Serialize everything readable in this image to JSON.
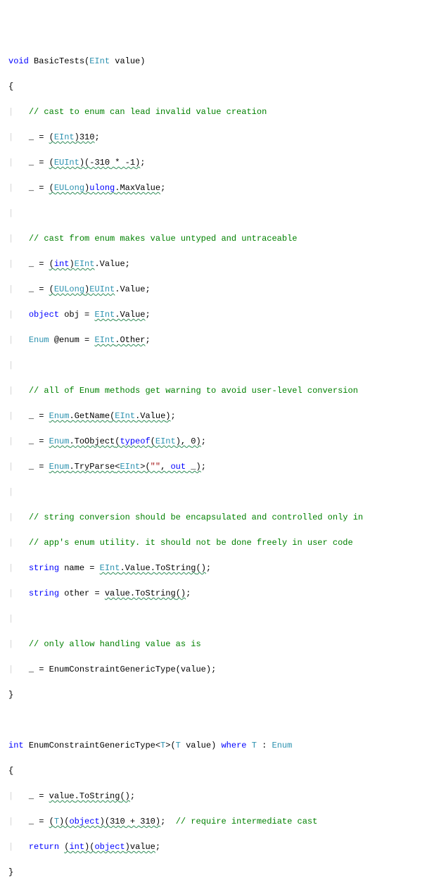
{
  "code": {
    "l1": {
      "kw_void": "void",
      "name": "BasicTests",
      "p_type": "EInt",
      "p_name": "value"
    },
    "l2": {
      "brace": "{"
    },
    "c1": "// cast to enum can lead invalid value creation",
    "l4": {
      "u": "_",
      "eq": "=",
      "cast_t": "EInt",
      "num": "310"
    },
    "l5": {
      "u": "_",
      "eq": "=",
      "cast_t": "EUInt",
      "expr_a": "-310",
      "star": "*",
      "expr_b": "-1"
    },
    "l6": {
      "u": "_",
      "eq": "=",
      "cast_t": "EULong",
      "t2": "ulong",
      "m": "MaxValue"
    },
    "c2": "// cast from enum makes value untyped and untraceable",
    "l9": {
      "u": "_",
      "eq": "=",
      "cast_t": "int",
      "t2": "EInt",
      "m": "Value"
    },
    "l10": {
      "u": "_",
      "eq": "=",
      "cast_t": "EULong",
      "t2": "EUInt",
      "m": "Value"
    },
    "l11": {
      "kw": "object",
      "v": "obj",
      "eq": "=",
      "t": "EInt",
      "m": "Value"
    },
    "l12": {
      "t": "Enum",
      "v": "@enum",
      "eq": "=",
      "t2": "EInt",
      "m": "Other"
    },
    "c3": "// all of Enum methods get warning to avoid user-level conversion",
    "l15": {
      "u": "_",
      "eq": "=",
      "t": "Enum",
      "m": "GetName",
      "a_t": "EInt",
      "a_m": "Value"
    },
    "l16": {
      "u": "_",
      "eq": "=",
      "t": "Enum",
      "m": "ToObject",
      "kw": "typeof",
      "a_t": "EInt",
      "num": "0"
    },
    "l17": {
      "u": "_",
      "eq": "=",
      "t": "Enum",
      "m": "TryParse",
      "g": "EInt",
      "s": "\"\"",
      "kw": "out",
      "u2": "_"
    },
    "c4a": "// string conversion should be encapsulated and controlled only in",
    "c4b": "// app's enum utility. it should not be done freely in user code",
    "l21": {
      "kw": "string",
      "v": "name",
      "eq": "=",
      "t": "EInt",
      "m": "Value",
      "fn": "ToString"
    },
    "l22": {
      "kw": "string",
      "v": "other",
      "eq": "=",
      "id": "value",
      "fn": "ToString"
    },
    "c5": "// only allow handling value as is",
    "l25": {
      "u": "_",
      "eq": "=",
      "fn": "EnumConstraintGenericType",
      "arg": "value"
    },
    "l26": {
      "brace": "}"
    },
    "l28": {
      "kw_int": "int",
      "name": "EnumConstraintGenericType",
      "g": "T",
      "p_type": "T",
      "p_name": "value",
      "kw_where": "where",
      "tc": "T",
      "kw_colon": ":",
      "base": "Enum"
    },
    "l29": {
      "brace": "{"
    },
    "l30": {
      "u": "_",
      "eq": "=",
      "id": "value",
      "fn": "ToString"
    },
    "l31": {
      "u": "_",
      "eq": "=",
      "c1": "T",
      "c2": "object",
      "a": "310",
      "plus": "+",
      "b": "310",
      "cm": "// require intermediate cast"
    },
    "l32": {
      "kw": "return",
      "c1": "int",
      "c2": "object",
      "id": "value"
    },
    "l33": {
      "brace": "}"
    }
  }
}
